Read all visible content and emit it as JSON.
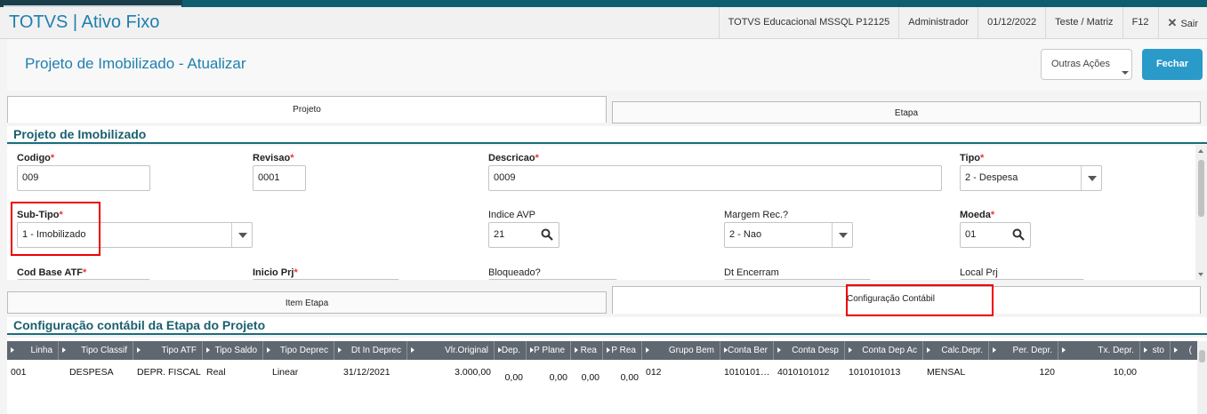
{
  "app": {
    "title": "TOTVS | Ativo Fixo",
    "env": "TOTVS Educacional MSSQL P12125",
    "user": "Administrador",
    "date": "01/12/2022",
    "branch": "Teste / Matriz",
    "f12": "F12",
    "exit": "Sair"
  },
  "page": {
    "title": "Projeto de Imobilizado - Atualizar",
    "actions_label": "Outras Ações",
    "close_label": "Fechar"
  },
  "tabs_top": [
    {
      "label": "Projeto"
    },
    {
      "label": "Etapa"
    }
  ],
  "section1": {
    "title": "Projeto de Imobilizado"
  },
  "form": {
    "codigo": {
      "label": "Codigo",
      "value": "009"
    },
    "revisao": {
      "label": "Revisao",
      "value": "0001"
    },
    "descricao": {
      "label": "Descricao",
      "value": "0009"
    },
    "tipo": {
      "label": "Tipo",
      "value": "2 - Despesa"
    },
    "subtipo": {
      "label": "Sub-Tipo",
      "value": "1 - Imobilizado"
    },
    "indice_avp": {
      "label": "Indice AVP",
      "value": "21"
    },
    "margem": {
      "label": "Margem Rec.?",
      "value": "2 - Nao"
    },
    "moeda": {
      "label": "Moeda",
      "value": "01"
    },
    "cod_base": {
      "label": "Cod Base ATF"
    },
    "inicio_prj": {
      "label": "Inicio Prj"
    },
    "bloqueado": {
      "label": "Bloqueado?"
    },
    "dt_encerram": {
      "label": "Dt Encerram"
    },
    "local_prj": {
      "label": "Local Prj"
    },
    "req_mark": "*"
  },
  "tabs_bottom": [
    {
      "label": "Item Etapa"
    },
    {
      "label": "Configuração Contábil"
    }
  ],
  "section2": {
    "title": "Configuração contábil da Etapa do Projeto"
  },
  "grid": {
    "columns": [
      "Linha",
      "Tipo Classif",
      "Tipo ATF",
      "Tipo Saldo",
      "Tipo Deprec",
      "Dt In Deprec",
      "Vlr.Original",
      "Dep.",
      "P Plane",
      "Rea",
      "P Rea",
      "Grupo Bem",
      "Conta Ber",
      "Conta Desp",
      "Conta Dep Ac",
      "Calc.Depr.",
      "Per. Depr.",
      "Tx. Depr.",
      "sto",
      "("
    ],
    "rows": [
      [
        "001",
        "DESPESA",
        "DEPR. FISCAL",
        "Real",
        "Linear",
        "31/12/2021",
        "3.000,00",
        "0,00",
        "0,00",
        "0,00",
        "0,00",
        "012",
        "1010101…",
        "4010101012",
        "1010101013",
        "MENSAL",
        "120",
        "10,00",
        "",
        ""
      ]
    ]
  },
  "colors": {
    "accent": "#1f7fb0",
    "section": "#1a5f6e",
    "primary_button": "#2a9ac9",
    "highlight": "#e00000"
  },
  "icons": {
    "search": "search-icon",
    "close": "close-icon",
    "dropdown": "chevron-down-icon"
  }
}
